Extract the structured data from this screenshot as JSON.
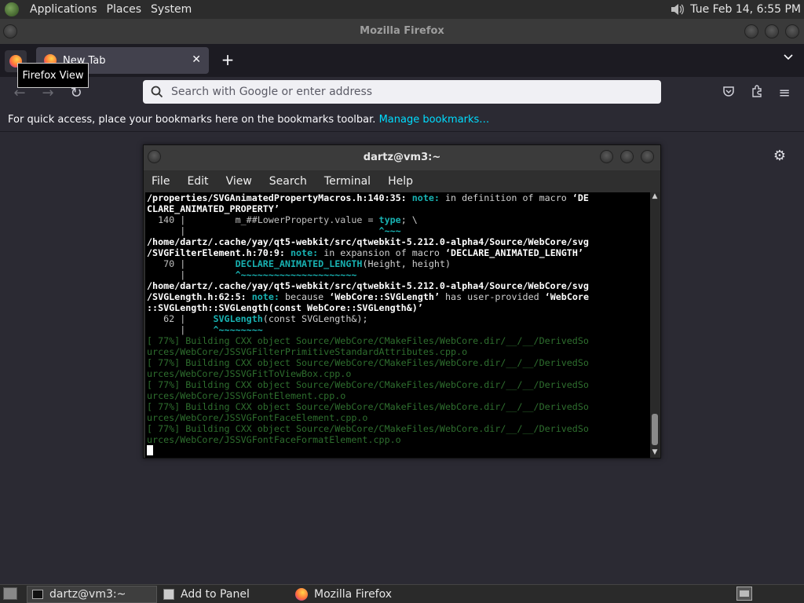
{
  "top_panel": {
    "menus": [
      "Applications",
      "Places",
      "System"
    ],
    "clock": "Tue Feb 14,  6:55 PM"
  },
  "firefox": {
    "window_title": "Mozilla Firefox",
    "tooltip": "Firefox View",
    "tab": {
      "label": "New Tab"
    },
    "url_placeholder": "Search with Google or enter address",
    "bookmarks_text": "For quick access, place your bookmarks here on the bookmarks toolbar.",
    "bookmarks_link": "Manage bookmarks…"
  },
  "terminal": {
    "title": "dartz@vm3:~",
    "menus": [
      "File",
      "Edit",
      "View",
      "Search",
      "Terminal",
      "Help"
    ],
    "lines": {
      "l1a": "/properties/SVGAnimatedPropertyMacros.h:140:35:",
      "l1b": "note:",
      "l1c": " in definition of macro ",
      "l1d": "‘DE",
      "l2": "CLARE_ANIMATED_PROPERTY’",
      "l3a": "  140 |         m_##LowerProperty.value = ",
      "l3b": "type",
      "l3c": "; \\",
      "l4a": "      |                                   ",
      "l4b": "^~~~",
      "l5": "/home/dartz/.cache/yay/qt5-webkit/src/qtwebkit-5.212.0-alpha4/Source/WebCore/svg",
      "l6a": "/SVGFilterElement.h:70:9:",
      "l6b": "note:",
      "l6c": " in expansion of macro ",
      "l6d": "‘DECLARE_ANIMATED_LENGTH’",
      "l7a": "   70 |         ",
      "l7b": "DECLARE_ANIMATED_LENGTH",
      "l7c": "(Height, height)",
      "l8a": "      |         ",
      "l8b": "^~~~~~~~~~~~~~~~~~~~~~",
      "l9": "/home/dartz/.cache/yay/qt5-webkit/src/qtwebkit-5.212.0-alpha4/Source/WebCore/svg",
      "l10a": "/SVGLength.h:62:5:",
      "l10b": "note:",
      "l10c": " because ",
      "l10d": "‘WebCore::SVGLength’",
      "l10e": " has user-provided ",
      "l10f": "‘WebCore",
      "l11": "::SVGLength::SVGLength(const WebCore::SVGLength&)’",
      "l12a": "   62 |     ",
      "l12b": "SVGLength",
      "l12c": "(const SVGLength&);",
      "l13a": "      |     ",
      "l13b": "^~~~~~~~~",
      "build": [
        [
          "[ 77%] Building CXX object Source/WebCore/CMakeFiles/WebCore.dir/__/__/DerivedSo",
          "urces/WebCore/JSSVGFilterPrimitiveStandardAttributes.cpp.o"
        ],
        [
          "[ 77%] Building CXX object Source/WebCore/CMakeFiles/WebCore.dir/__/__/DerivedSo",
          "urces/WebCore/JSSVGFitToViewBox.cpp.o"
        ],
        [
          "[ 77%] Building CXX object Source/WebCore/CMakeFiles/WebCore.dir/__/__/DerivedSo",
          "urces/WebCore/JSSVGFontElement.cpp.o"
        ],
        [
          "[ 77%] Building CXX object Source/WebCore/CMakeFiles/WebCore.dir/__/__/DerivedSo",
          "urces/WebCore/JSSVGFontFaceElement.cpp.o"
        ],
        [
          "[ 77%] Building CXX object Source/WebCore/CMakeFiles/WebCore.dir/__/__/DerivedSo",
          "urces/WebCore/JSSVGFontFaceFormatElement.cpp.o"
        ]
      ]
    }
  },
  "bottom_panel": {
    "tasks": [
      "dartz@vm3:~",
      "Add to Panel",
      "Mozilla Firefox"
    ]
  }
}
